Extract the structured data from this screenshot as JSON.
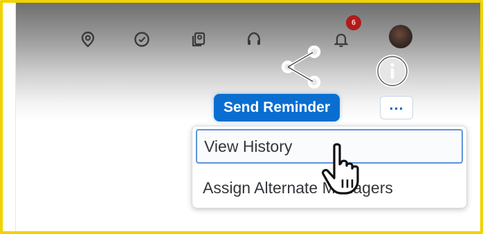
{
  "shellbar": {
    "icons": [
      "location-pin-icon",
      "checkmark-circle-icon",
      "contacts-icon",
      "headset-icon",
      "bell-icon"
    ],
    "notification_count": "6",
    "avatar": "user-avatar"
  },
  "actions": {
    "share_icon": "share-icon",
    "info_icon": "info-icon",
    "send_reminder_label": "Send Reminder",
    "more_label": "...",
    "accent_color": "#0a6ed1"
  },
  "menu": {
    "items": [
      {
        "label": "View History",
        "highlighted": true
      },
      {
        "label": "Assign Alternate Managers",
        "highlighted": false
      }
    ]
  },
  "frame_color": "#f2d200"
}
